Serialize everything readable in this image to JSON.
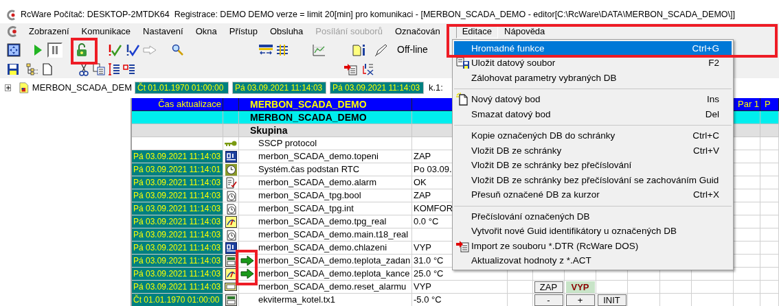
{
  "window": {
    "title": "RcWare Počítač: DESKTOP-2MTDK64  Registrace: DEMO DEMO verze = limit 20[min] pro komunikaci - [MERBON_SCADA_DEMO - editor[C:\\RcWare\\DATA\\MERBON_SCADA_DEMO\\]]"
  },
  "menu_bar": [
    {
      "label": "Zobrazení",
      "selected": false,
      "disabled": false
    },
    {
      "label": "Komunikace",
      "selected": false,
      "disabled": false
    },
    {
      "label": "Nastavení",
      "selected": false,
      "disabled": false
    },
    {
      "label": "Okna",
      "selected": false,
      "disabled": false
    },
    {
      "label": "Přístup",
      "selected": false,
      "disabled": false
    },
    {
      "label": "Obsluha",
      "selected": false,
      "disabled": false
    },
    {
      "label": "Posílání souborů",
      "selected": false,
      "disabled": true
    },
    {
      "label": "Označován",
      "selected": false,
      "disabled": false
    },
    {
      "label": "Editace",
      "selected": true,
      "disabled": false
    },
    {
      "label": "Nápověda",
      "selected": false,
      "disabled": false
    }
  ],
  "toolbar": {
    "pause_pressed": true,
    "status": "Off-line"
  },
  "tree": {
    "items": [
      {
        "label": "MERBON_SCADA_DEM",
        "expanded": false
      }
    ]
  },
  "timestamps": [
    "Čt 01.01.1970 01:00:00",
    "Pá 03.09.2021 11:14:03",
    "Pá 03.09.2021 11:14:03"
  ],
  "channel_label": "k.1:",
  "grid": {
    "header": {
      "time": "Čas aktualizace",
      "name": "MERBON_SCADA_DEMO",
      "par1": "Par 1",
      "column_13": "P"
    },
    "title_row": "MERBON_SCADA_DEMO",
    "group_row": "Skupina",
    "rows": [
      {
        "kind": "protocol",
        "name": "SSCP protocol",
        "arrow": false
      },
      {
        "time": "Pá 03.09.2021 11:14:03",
        "kind": "binary",
        "name": "merbon_SCADA_demo.topeni",
        "value": "ZAP",
        "arrow": false
      },
      {
        "time": "Pá 03.09.2021 11:14:01",
        "kind": "clock",
        "name": "Systém.čas podstan RTC",
        "value": "Po 03.09.",
        "arrow": false
      },
      {
        "time": "Pá 03.09.2021 11:14:03",
        "kind": "alarm",
        "name": "merbon_SCADA_demo.alarm",
        "value": "OK",
        "arrow": false
      },
      {
        "time": "Pá 03.09.2021 11:14:03",
        "kind": "timer",
        "name": "merbon_SCADA_tpg.bool",
        "value": "ZAP",
        "arrow": false
      },
      {
        "time": "Pá 03.09.2021 11:14:03",
        "kind": "timer",
        "name": "merbon_SCADA_tpg.int",
        "value": "KOMFOR",
        "arrow": false
      },
      {
        "time": "Pá 03.09.2021 11:14:03",
        "kind": "gauge",
        "name": "merbon_SCADA_demo.tpg_real",
        "value": "0.0 °C",
        "arrow": false
      },
      {
        "time": "Pá 03.09.2021 11:14:03",
        "kind": "timer",
        "name": "merbon_SCADA_demo.main.t18_real",
        "arrow": false
      },
      {
        "time": "Pá 03.09.2021 11:14:03",
        "kind": "binary",
        "name": "merbon_SCADA_demo.chlazeni",
        "value": "VYP",
        "arrow": false
      },
      {
        "time": "Pá 03.09.2021 11:14:03",
        "kind": "display",
        "name": "merbon_SCADA_demo.teplota_zadan",
        "value": "31.0 °C",
        "arrow": true
      },
      {
        "time": "Pá 03.09.2021 11:14:03",
        "kind": "gauge",
        "name": "merbon_SCADA_demo.teplota_kance",
        "value": "25.0 °C",
        "arrow": true
      },
      {
        "time": "Pá 03.09.2021 11:14:03",
        "kind": "ok",
        "name": "merbon_SCADA_demo.reset_alarmu",
        "value": "VYP",
        "arrow": false,
        "controls": [
          {
            "label": "ZAP",
            "selected": false
          },
          {
            "label": "VYP",
            "selected": true
          }
        ]
      },
      {
        "time": "Čt 01.01.1970 01:00:00",
        "kind": "display",
        "name": "ekviterma_kotel.tx1",
        "value": "-5.0 °C",
        "arrow": false,
        "controls": [
          {
            "label": "-"
          },
          {
            "label": "+"
          },
          {
            "label": "INIT"
          }
        ]
      }
    ]
  },
  "dropdown": {
    "items": [
      {
        "kind": "plain",
        "label": "Hromadné funkce",
        "shortcut": "Ctrl+G",
        "selected": true,
        "separator_before": false
      },
      {
        "kind": "save",
        "label": "Uložit datový soubor",
        "shortcut": "F2",
        "selected": false,
        "separator_before": false
      },
      {
        "kind": "plain",
        "label": "Zálohovat parametry vybraných DB",
        "selected": false,
        "separator_before": false
      },
      {
        "kind": "new",
        "label": "Nový datový bod",
        "shortcut": "Ins",
        "selected": false,
        "separator_before": true
      },
      {
        "kind": "plain",
        "label": "Smazat datový bod",
        "shortcut": "Del",
        "selected": false,
        "separator_before": false
      },
      {
        "kind": "plain",
        "label": "Kopie označených DB do schránky",
        "shortcut": "Ctrl+C",
        "selected": false,
        "separator_before": true
      },
      {
        "kind": "plain",
        "label": "Vložit DB ze schránky",
        "shortcut": "Ctrl+V",
        "selected": false,
        "separator_before": false
      },
      {
        "kind": "plain",
        "label": "Vložit DB ze schránky bez přečíslování",
        "selected": false,
        "separator_before": false
      },
      {
        "kind": "plain",
        "label": "Vložit DB ze schránky bez přečíslování se zachováním Guid",
        "selected": false,
        "separator_before": false
      },
      {
        "kind": "plain",
        "label": "Přesuň označené DB za kurzor",
        "shortcut": "Ctrl+X",
        "selected": false,
        "separator_before": false
      },
      {
        "kind": "plain",
        "label": "Přečíslování označených DB",
        "selected": false,
        "separator_before": true
      },
      {
        "kind": "plain",
        "label": "Vytvořit nové Guid identifikátory u označených DB",
        "selected": false,
        "separator_before": false
      },
      {
        "kind": "import",
        "label": "Import ze souboru *.DTR (RcWare DOS)",
        "selected": false,
        "separator_before": false
      },
      {
        "kind": "plain",
        "label": "Aktualizovat hodnoty z *.ACT",
        "selected": false,
        "separator_before": false
      }
    ]
  }
}
